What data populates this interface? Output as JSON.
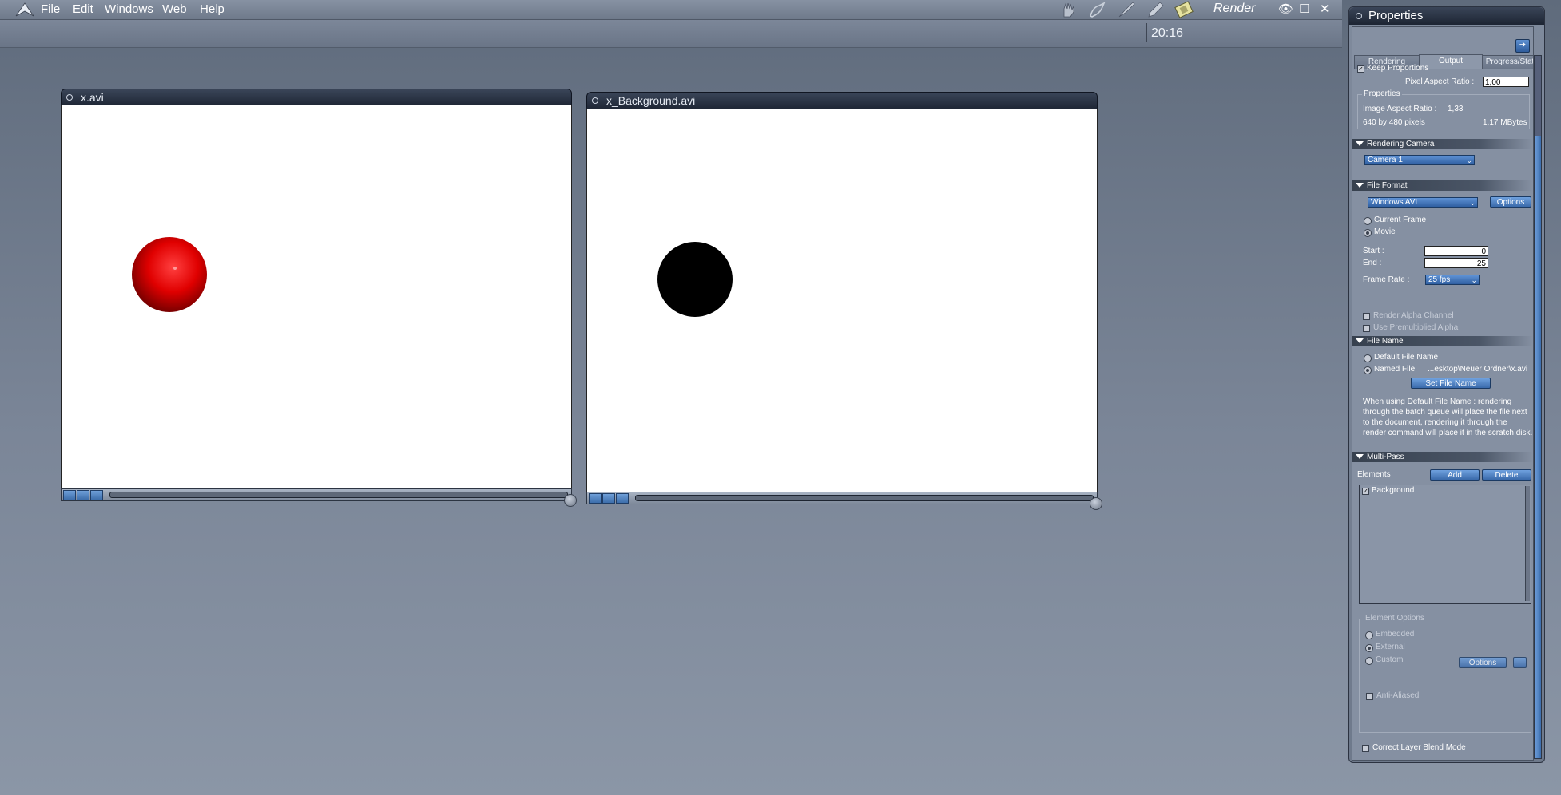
{
  "menubar": {
    "items": [
      "File",
      "Edit",
      "Windows",
      "Web",
      "Help"
    ],
    "mode_label": "Render",
    "tool_icons": [
      "hand-icon",
      "pen-tool-icon",
      "brush-icon",
      "pencil-icon",
      "film-icon"
    ],
    "window_controls": [
      "eye-icon",
      "maximize-icon",
      "close-icon"
    ]
  },
  "status": {
    "time": "20:16"
  },
  "movies": [
    {
      "title": "x.avi",
      "ball_color": "#e00000"
    },
    {
      "title": "x_Background.avi",
      "ball_color": "#000000"
    }
  ],
  "properties": {
    "title": "Properties",
    "tabs": [
      "Rendering",
      "Output",
      "Progress/Statist"
    ],
    "active_tab": "Output",
    "keep_proportions": "Keep Proportions",
    "pixel_aspect_label": "Pixel Aspect Ratio :",
    "pixel_aspect_value": "1,00",
    "props_group": "Properties",
    "image_aspect_label": "Image Aspect Ratio :",
    "image_aspect_value": "1,33",
    "pixels_label": "640 by 480 pixels",
    "size_label": "1,17 MBytes",
    "rendering_camera": {
      "header": "Rendering Camera",
      "camera": "Camera 1"
    },
    "file_format": {
      "header": "File Format",
      "format": "Windows AVI",
      "options_label": "Options",
      "current_frame": "Current Frame",
      "movie": "Movie",
      "start_label": "Start :",
      "start_value": "0",
      "end_label": "End :",
      "end_value": "25",
      "frame_rate_label": "Frame Rate :",
      "frame_rate": "25 fps",
      "render_alpha": "Render Alpha Channel",
      "premult_alpha": "Use Premultiplied Alpha"
    },
    "file_name": {
      "header": "File Name",
      "default": "Default File Name",
      "named": "Named File:",
      "path": "...esktop\\Neuer Ordner\\x.avi",
      "set_button": "Set File Name",
      "note_lines": [
        "When using Default File Name : rendering",
        "through the batch queue will place the file next",
        "to the document, rendering it through the",
        "render command will place it in the scratch disk."
      ]
    },
    "multipass": {
      "header": "Multi-Pass",
      "elements_label": "Elements",
      "add": "Add",
      "delete": "Delete",
      "items": [
        "Background"
      ],
      "element_options": "Element Options",
      "embedded": "Embedded",
      "external": "External",
      "custom": "Custom",
      "options": "Options",
      "anti_aliased": "Anti-Aliased",
      "correct_blend": "Correct Layer Blend Mode"
    }
  }
}
